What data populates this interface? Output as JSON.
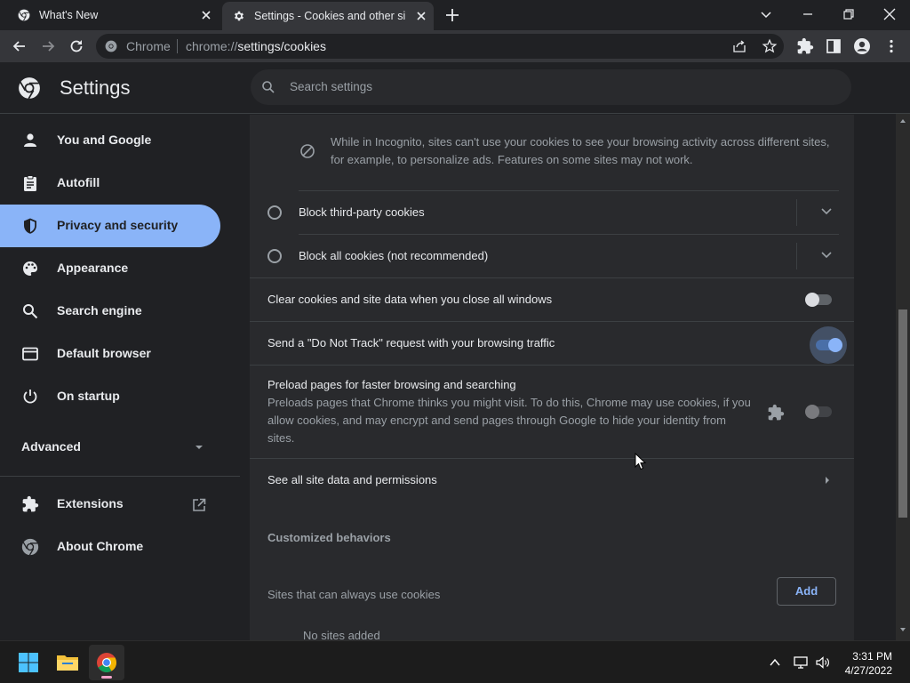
{
  "tabs": [
    {
      "title": "What's New"
    },
    {
      "title": "Settings - Cookies and other site"
    }
  ],
  "toolbar": {
    "omnibox_prefix": "Chrome",
    "url_scheme": "chrome://",
    "url_path": "settings/cookies"
  },
  "header": {
    "title": "Settings",
    "search_placeholder": "Search settings"
  },
  "sidebar": {
    "items": [
      {
        "label": "You and Google"
      },
      {
        "label": "Autofill"
      },
      {
        "label": "Privacy and security"
      },
      {
        "label": "Appearance"
      },
      {
        "label": "Search engine"
      },
      {
        "label": "Default browser"
      },
      {
        "label": "On startup"
      }
    ],
    "advanced": "Advanced",
    "extensions": "Extensions",
    "about": "About Chrome"
  },
  "main": {
    "incognito_note_1": "While in Incognito, sites can't use your cookies to see your browsing activity across different sites,",
    "incognito_note_2": "for example, to personalize ads. Features on some sites may not work.",
    "block_third_party": "Block third-party cookies",
    "block_all": "Block all cookies (not recommended)",
    "clear_on_close": "Clear cookies and site data when you close all windows",
    "clear_on_close_enabled": false,
    "do_not_track": "Send a \"Do Not Track\" request with your browsing traffic",
    "do_not_track_enabled": true,
    "preload_title": "Preload pages for faster browsing and searching",
    "preload_desc_1": "Preloads pages that Chrome thinks you might visit. To do this, Chrome may use cookies, if you",
    "preload_desc_2": "allow cookies, and may encrypt and send pages through Google to hide your identity from",
    "preload_desc_3": "sites.",
    "preload_enabled": false,
    "see_all": "See all site data and permissions",
    "customized_behaviors": "Customized behaviors",
    "always_use": "Sites that can always use cookies",
    "add_button": "Add",
    "no_sites": "No sites added"
  },
  "taskbar": {
    "time": "3:31 PM",
    "date": "4/27/2022"
  },
  "colors": {
    "accent": "#8ab4f8",
    "background": "#202124",
    "card": "#292a2d"
  }
}
